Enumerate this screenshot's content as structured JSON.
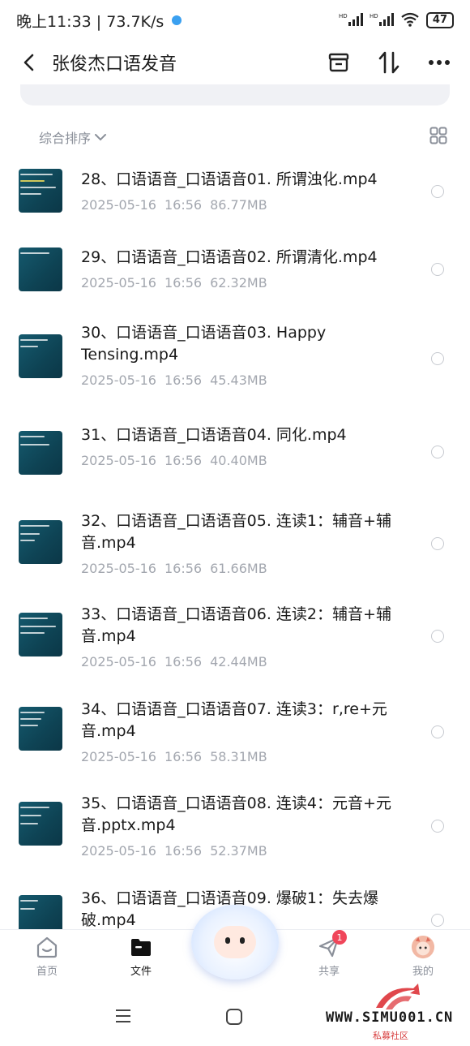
{
  "status_bar": {
    "time_speed": "晚上11:33 | 73.7K/s",
    "network_1": "HD",
    "network_2": "HD",
    "battery": "47"
  },
  "header": {
    "title": "张俊杰口语发音",
    "icons": [
      "back-icon",
      "archive-box-icon",
      "sort-arrows-icon",
      "more-icon"
    ]
  },
  "sort": {
    "label": "综合排序"
  },
  "files": [
    {
      "name": "28、口语语音_口语语音01. 所谓浊化.mp4",
      "date": "2025-05-16",
      "time": "16:56",
      "size": "86.77MB"
    },
    {
      "name": "29、口语语音_口语语音02. 所谓清化.mp4",
      "date": "2025-05-16",
      "time": "16:56",
      "size": "62.32MB"
    },
    {
      "name": "30、口语语音_口语语音03. Happy Tensing.mp4",
      "date": "2025-05-16",
      "time": "16:56",
      "size": "45.43MB"
    },
    {
      "name": "31、口语语音_口语语音04. 同化.mp4",
      "date": "2025-05-16",
      "time": "16:56",
      "size": "40.40MB"
    },
    {
      "name": "32、口语语音_口语语音05. 连读1：辅音+辅音.mp4",
      "date": "2025-05-16",
      "time": "16:56",
      "size": "61.66MB"
    },
    {
      "name": "33、口语语音_口语语音06. 连读2：辅音+辅音.mp4",
      "date": "2025-05-16",
      "time": "16:56",
      "size": "42.44MB"
    },
    {
      "name": "34、口语语音_口语语音07. 连读3：r,re+元音.mp4",
      "date": "2025-05-16",
      "time": "16:56",
      "size": "58.31MB"
    },
    {
      "name": "35、口语语音_口语语音08. 连读4：元音+元音.pptx.mp4",
      "date": "2025-05-16",
      "time": "16:56",
      "size": "52.37MB"
    },
    {
      "name": "36、口语语音_口语语音09. 爆破1：失去爆破.mp4",
      "date": "",
      "time": "",
      "size": ""
    }
  ],
  "tabs": [
    {
      "label": "首页",
      "icon": "home-icon"
    },
    {
      "label": "文件",
      "icon": "folder-icon",
      "active": true
    },
    {
      "label": "",
      "icon": "mascot-icon"
    },
    {
      "label": "共享",
      "icon": "share-icon",
      "badge": "1"
    },
    {
      "label": "我的",
      "icon": "avatar-icon"
    }
  ],
  "watermark": {
    "text": "WWW.SIMU001.CN",
    "sub": "私募社区"
  },
  "colors": {
    "accent": "#1a1a1a",
    "muted": "#8a8f99",
    "meta": "#a3a7af",
    "badge": "#f0465a",
    "thumb": "#0e4354"
  }
}
